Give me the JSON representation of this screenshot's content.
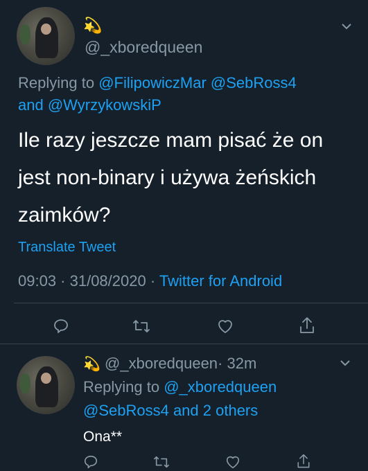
{
  "main_tweet": {
    "emoji": "💫",
    "handle": "@_xboredqueen",
    "replying_prefix": "Replying to",
    "reply_mention_1": "@FilipowiczMar",
    "reply_mention_2": "@SebRoss4",
    "reply_and": "and",
    "reply_mention_3": "@WyrzykowskiP",
    "text_line1": "Ile razy jeszcze mam pisać że on",
    "text_line2": "jest non-binary i używa żeńskich",
    "text_line3": "zaimków?",
    "translate": "Translate Tweet",
    "meta_time": "09:03 · 31/08/2020 ·",
    "meta_source": "Twitter for Android"
  },
  "reply_tweet": {
    "emoji": "💫",
    "handle": "@_xboredqueen",
    "time": "· 32m",
    "replying_prefix": "Replying to",
    "reply_mention_1": "@_xboredqueen",
    "reply_line2": "@SebRoss4 and 2 others",
    "text": "Ona**"
  },
  "colors": {
    "background": "#15202b",
    "accent": "#1da1f2",
    "muted": "#8899a6",
    "divider": "#38444d"
  },
  "icons": [
    "reply-icon",
    "retweet-icon",
    "like-icon",
    "share-icon",
    "chevron-down-icon",
    "sparkle-emoji"
  ]
}
